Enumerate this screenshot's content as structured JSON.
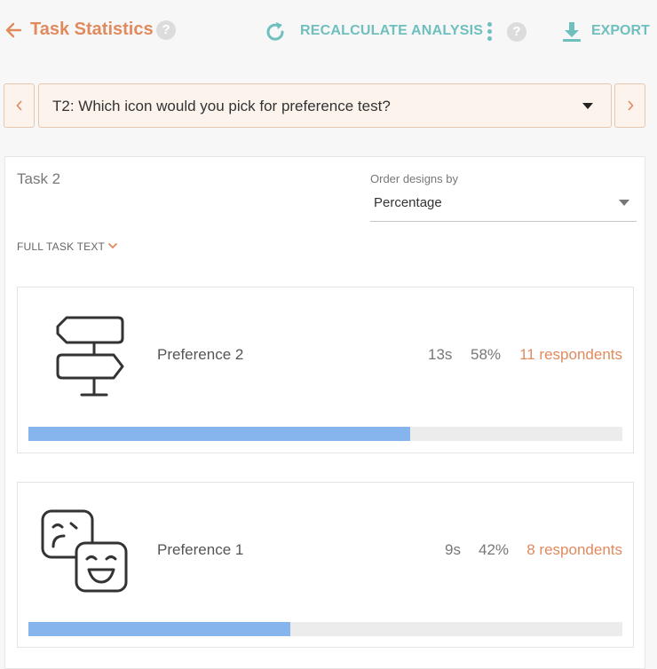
{
  "header": {
    "title": "Task Statistics",
    "help_glyph": "?",
    "recalculate_label": "RECALCULATE ANALYSIS",
    "export_label": "EXPORT",
    "accent_color": "#e08a5d",
    "action_color": "#6fbfbf"
  },
  "task_selector": {
    "selected": "T2: Which icon would you pick for preference test?"
  },
  "task": {
    "heading": "Task 2",
    "order_label": "Order designs by",
    "order_value": "Percentage",
    "full_text_label": "FULL TASK TEXT"
  },
  "designs": [
    {
      "name": "Preference 2",
      "time": "13s",
      "percent": "58%",
      "respondents": "11 respondents",
      "bar_fraction": 0.643,
      "icon": "signpost-icon"
    },
    {
      "name": "Preference 1",
      "time": "9s",
      "percent": "42%",
      "respondents": "8 respondents",
      "bar_fraction": 0.441,
      "icon": "emotions-faces-icon"
    }
  ]
}
